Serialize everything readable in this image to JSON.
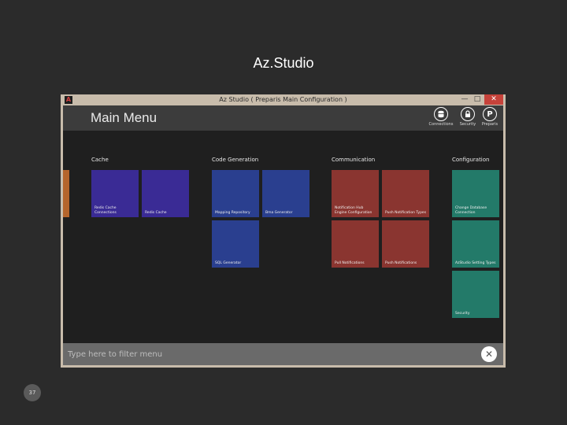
{
  "slide": {
    "title": "Az.Studio",
    "number": "37"
  },
  "window": {
    "title": "Az Studio ( Preparis Main Configuration )",
    "controls": {
      "minimize": "—",
      "maximize": "□",
      "close": "✕"
    },
    "app_icon": "adobe-style-app-icon"
  },
  "header": {
    "title": "Main Menu",
    "icons": [
      {
        "name": "connections-icon",
        "label": "Connections"
      },
      {
        "name": "security-lock-icon",
        "label": "Security"
      },
      {
        "name": "preparis-p-icon",
        "label": "Preparis"
      }
    ]
  },
  "sections": [
    {
      "title": "Cache",
      "tiles": [
        {
          "label": "Redis Cache Connections",
          "color": "#3a2b95"
        },
        {
          "label": "Redis Cache",
          "color": "#3a2b95"
        }
      ]
    },
    {
      "title": "Code Generation",
      "tiles": [
        {
          "label": "Mapping Repository",
          "color": "#2a3f8f"
        },
        {
          "label": "Bma Generator",
          "color": "#2a3f8f"
        },
        {
          "label": "SQL Generator",
          "color": "#2a3f8f"
        }
      ]
    },
    {
      "title": "Communication",
      "tiles": [
        {
          "label": "Notification Hub Engine Configuration",
          "color": "#8a3530"
        },
        {
          "label": "Push Notification Types",
          "color": "#8a3530"
        },
        {
          "label": "Pull Notifications",
          "color": "#8a3530"
        },
        {
          "label": "Push Notifications",
          "color": "#8a3530"
        }
      ]
    },
    {
      "title": "Configuration",
      "tiles": [
        {
          "label": "Change Database Connection",
          "color": "#237a69"
        },
        {
          "label": "AzStudio Setting Types",
          "color": "#237a69"
        },
        {
          "label": "Security",
          "color": "#237a69"
        }
      ]
    }
  ],
  "filter": {
    "placeholder": "Type here to filter menu",
    "value": ""
  }
}
